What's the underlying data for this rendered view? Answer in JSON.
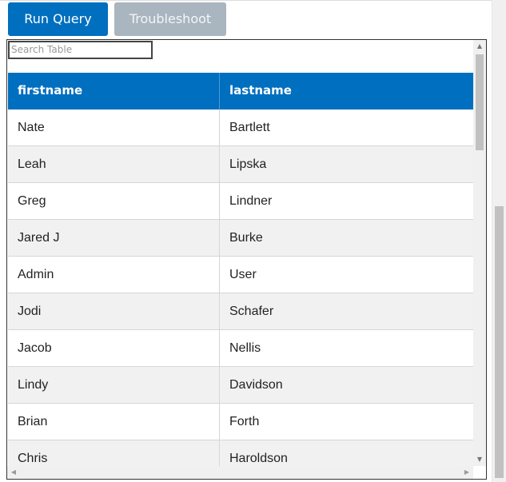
{
  "toolbar": {
    "run_label": "Run Query",
    "troubleshoot_label": "Troubleshoot"
  },
  "search": {
    "placeholder": "Search Table"
  },
  "table": {
    "columns": [
      "firstname",
      "lastname"
    ],
    "rows": [
      [
        "Nate",
        "Bartlett"
      ],
      [
        "Leah",
        "Lipska"
      ],
      [
        "Greg",
        "Lindner"
      ],
      [
        "Jared J",
        "Burke"
      ],
      [
        "Admin",
        "User"
      ],
      [
        "Jodi",
        "Schafer"
      ],
      [
        "Jacob",
        "Nellis"
      ],
      [
        "Lindy",
        "Davidson"
      ],
      [
        "Brian",
        "Forth"
      ],
      [
        "Chris",
        "Haroldson"
      ]
    ]
  },
  "colors": {
    "primary": "#006fbf",
    "disabled": "#a9b5bf",
    "row_alt": "#f1f1f1"
  },
  "icons": {
    "scroll_up": "triangle-up-icon",
    "scroll_down": "triangle-down-icon",
    "scroll_left": "triangle-left-icon",
    "scroll_right": "triangle-right-icon"
  }
}
